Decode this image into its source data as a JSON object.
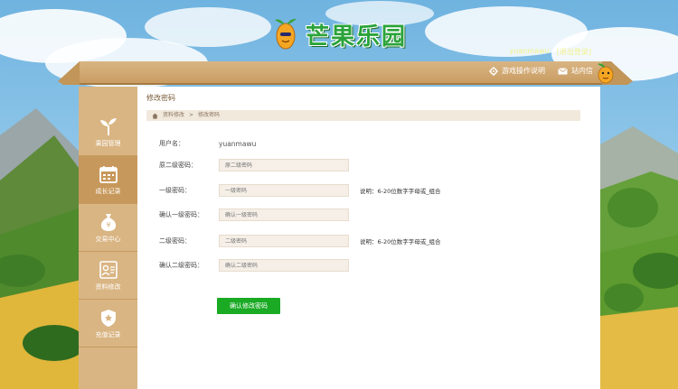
{
  "brand": {
    "name": "芒果乐园"
  },
  "user_bar": {
    "username": "yuanmawu",
    "logout": "[退出登录]"
  },
  "topbar": {
    "game_help": "游戏操作说明",
    "inbox": "站内信"
  },
  "sidebar": {
    "items": [
      {
        "label": "果园管理",
        "icon": "sprout-icon"
      },
      {
        "label": "成长记录",
        "icon": "calendar-icon"
      },
      {
        "label": "交易中心",
        "icon": "money-bag-icon"
      },
      {
        "label": "资料修改",
        "icon": "profile-card-icon"
      },
      {
        "label": "充值记录",
        "icon": "shield-badge-icon"
      }
    ],
    "active_index": 1
  },
  "main": {
    "title": "修改密码",
    "breadcrumb": {
      "home": "资料修改",
      "sep": ">",
      "current": "修改密码"
    },
    "form": {
      "username_label": "用户名：",
      "username_value": "yuanmawu",
      "second_pwd_label": "原二级密码：",
      "second_pwd_placeholder": "原二级密码",
      "first_pwd_label": "一级密码：",
      "first_pwd_placeholder": "一级密码",
      "first_pwd_note": "说明：6-20位数字字母或_组合",
      "confirm_first_label": "确认一级密码：",
      "confirm_first_placeholder": "确认一级密码",
      "second_new_label": "二级密码：",
      "second_new_placeholder": "二级密码",
      "second_new_note": "说明：6-20位数字字母或_组合",
      "confirm_second_label": "确认二级密码：",
      "confirm_second_placeholder": "确认二级密码",
      "submit_label": "确认修改密码"
    }
  },
  "colors": {
    "wood": "#d9b583",
    "wood_dark": "#c7985b",
    "button_green": "#1aaa24",
    "logo_green": "#2aa33a"
  }
}
